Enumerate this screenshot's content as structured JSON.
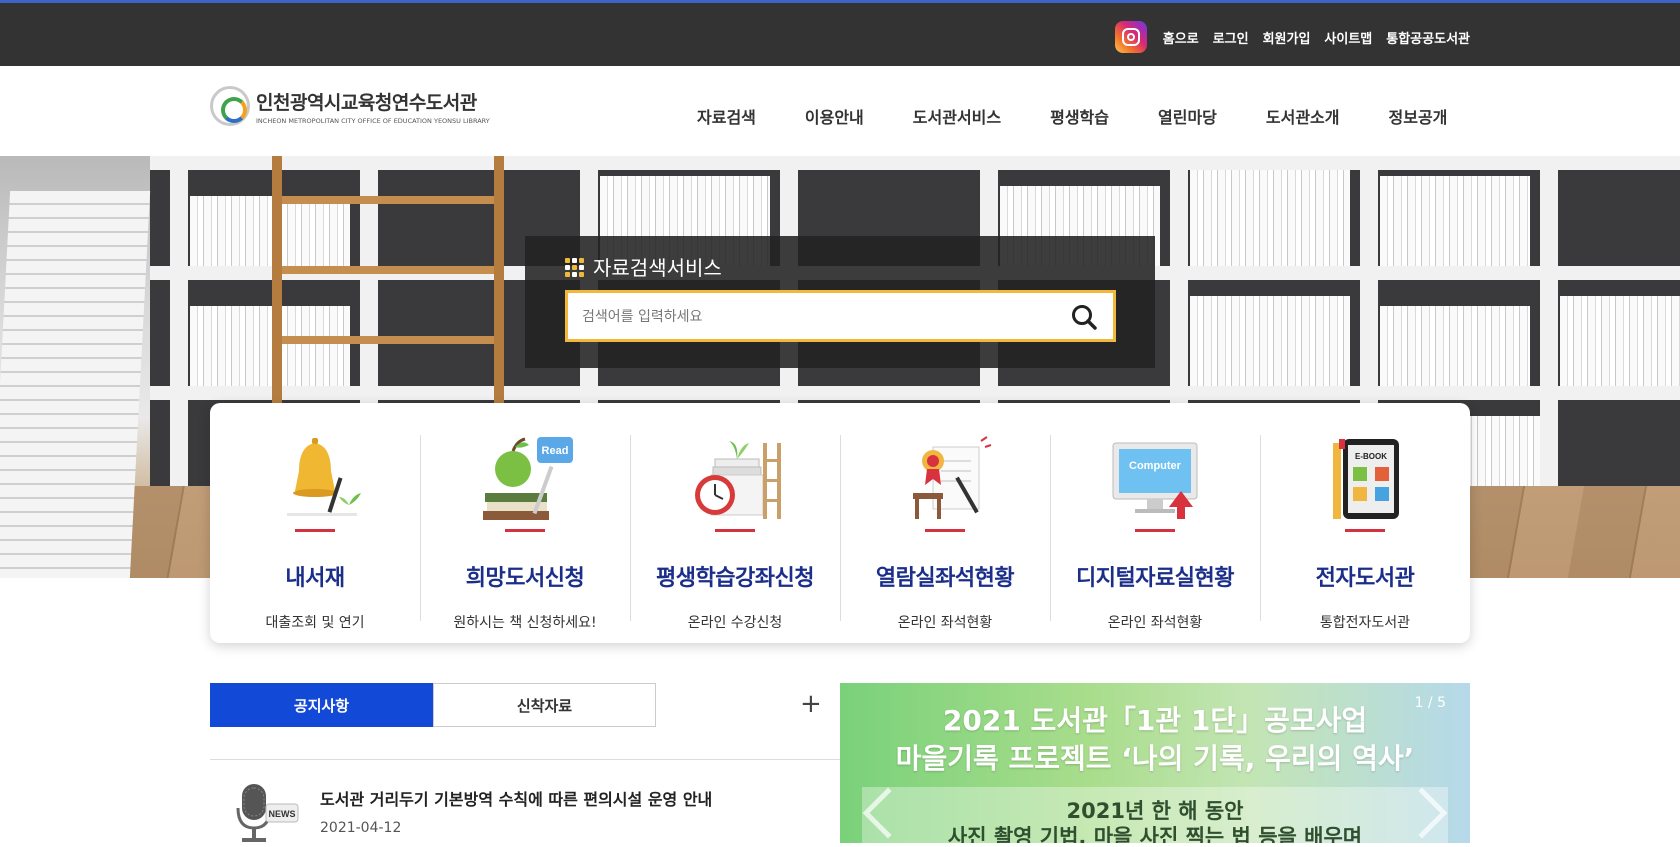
{
  "top_util": {
    "instagram_icon": "instagram-icon",
    "links": [
      "홈으로",
      "로그인",
      "회원가입",
      "사이트맵",
      "통합공공도서관"
    ]
  },
  "logo": {
    "title": "인천광역시교육청연수도서관",
    "subtitle": "INCHEON METROPOLITAN CITY OFFICE OF EDUCATION YEONSU LIBRARY"
  },
  "gnb": [
    "자료검색",
    "이용안내",
    "도서관서비스",
    "평생학습",
    "열린마당",
    "도서관소개",
    "정보공개"
  ],
  "search": {
    "title": "자료검색서비스",
    "placeholder": "검색어를 입력하세요",
    "value": ""
  },
  "quick_menu": [
    {
      "title": "내서재",
      "sub": "대출조회 및 연기",
      "icon": "bell-icon"
    },
    {
      "title": "희망도서신청",
      "sub": "원하시는 책 신청하세요!",
      "icon": "apple-books-icon"
    },
    {
      "title": "평생학습강좌신청",
      "sub": "온라인 수강신청",
      "icon": "clock-books-icon"
    },
    {
      "title": "열람실좌석현황",
      "sub": "온라인 좌석현황",
      "icon": "seat-checklist-icon"
    },
    {
      "title": "디지털자료실현황",
      "sub": "온라인 좌석현황",
      "icon": "computer-icon"
    },
    {
      "title": "전자도서관",
      "sub": "통합전자도서관",
      "icon": "ebook-icon"
    }
  ],
  "tabs": [
    "공지사항",
    "신착자료"
  ],
  "more_label": "+",
  "notice": {
    "title": "도서관 거리두기 기본방역 수칙에 따른 편의시설 운영 안내",
    "date": "2021-04-12"
  },
  "banner": {
    "line1": "2021 도서관「1관 1단」공모사업",
    "line2": "마을기록 프로젝트 ‘나의 기록, 우리의 역사’",
    "line3": "2021년 한 해 동안",
    "line4": "사진 촬영 기법, 마을 사진 찍는 법 등을 배우며",
    "pager": "1 / 5"
  },
  "colors": {
    "topbar": "#333333",
    "accent_blue": "#1249d6",
    "title_navy": "#1b2f8a",
    "search_border": "#f2b83a",
    "red_bar": "#d5323f"
  }
}
